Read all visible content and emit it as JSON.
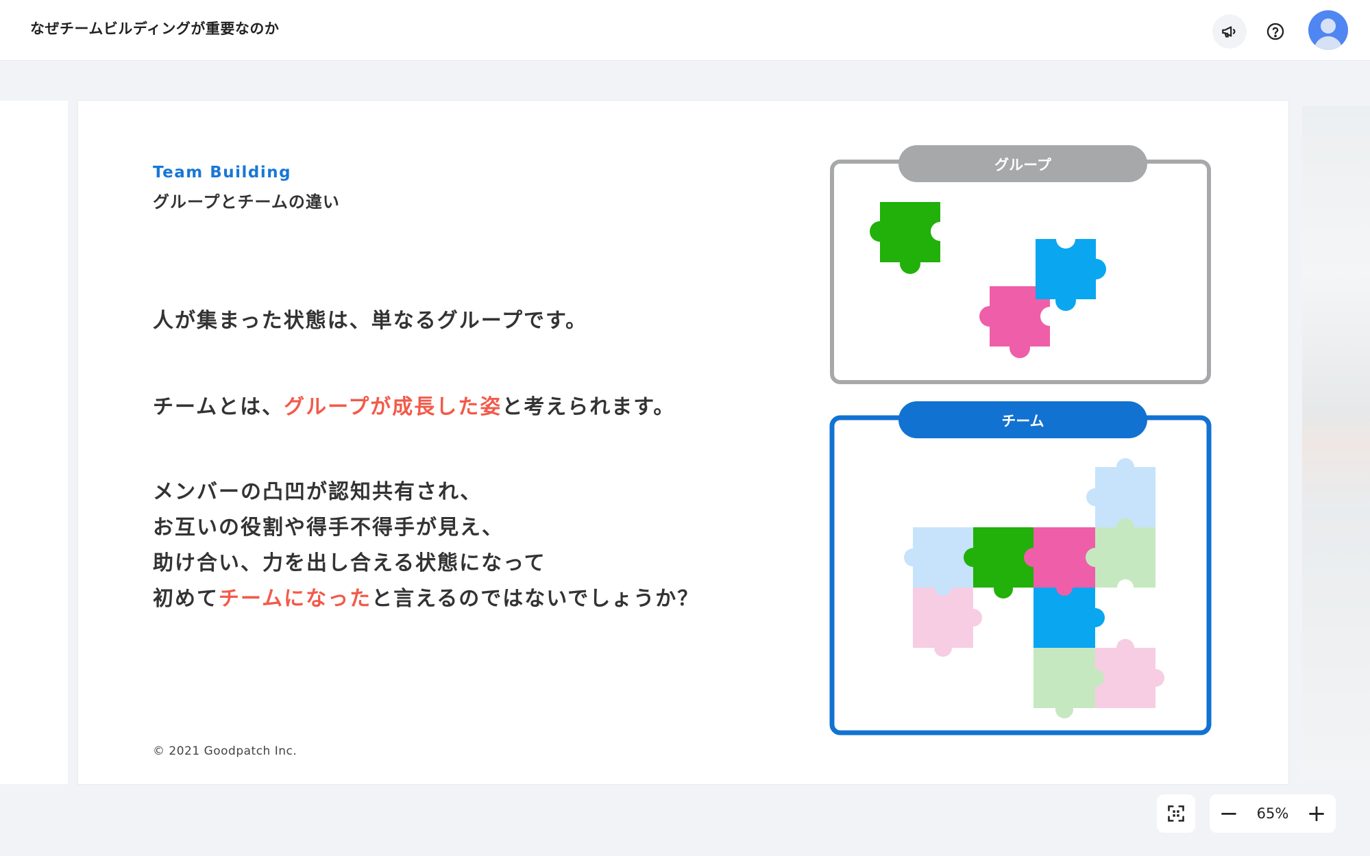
{
  "header": {
    "title": "なぜチームビルディングが重要なのか"
  },
  "slide": {
    "eyebrow": "Team Building",
    "subtitle": "グループとチームの違い",
    "paragraph1": "人が集まった状態は、単なるグループです。",
    "paragraph2": {
      "before": "チームとは、",
      "highlight": "グループが成長した姿",
      "after": "と考えられます。"
    },
    "paragraph3": {
      "line1": "メンバーの凸凹が認知共有され、",
      "line2": "お互いの役割や得手不得手が見え、",
      "line3": "助け合い、力を出し合える状態になって",
      "line4_before": "初めて",
      "line4_highlight": "チームになった",
      "line4_after": "と言えるのではないでしょうか？"
    },
    "copyright": "© 2021 Goodpatch Inc.",
    "diagram": {
      "group_label": "グループ",
      "team_label": "チーム"
    }
  },
  "zoom": {
    "level": "65%",
    "minus": "−",
    "plus": "+"
  },
  "colors": {
    "accent_blue": "#1877d6",
    "highlight_red": "#f25a4a",
    "group_gray": "#a6a8aa",
    "piece_green": "#22b00a",
    "piece_pink": "#ef5ea8",
    "piece_blue": "#0aa6f0"
  },
  "icons": [
    "megaphone-icon",
    "help-circle-icon",
    "user-avatar-icon",
    "fit-screen-icon"
  ]
}
